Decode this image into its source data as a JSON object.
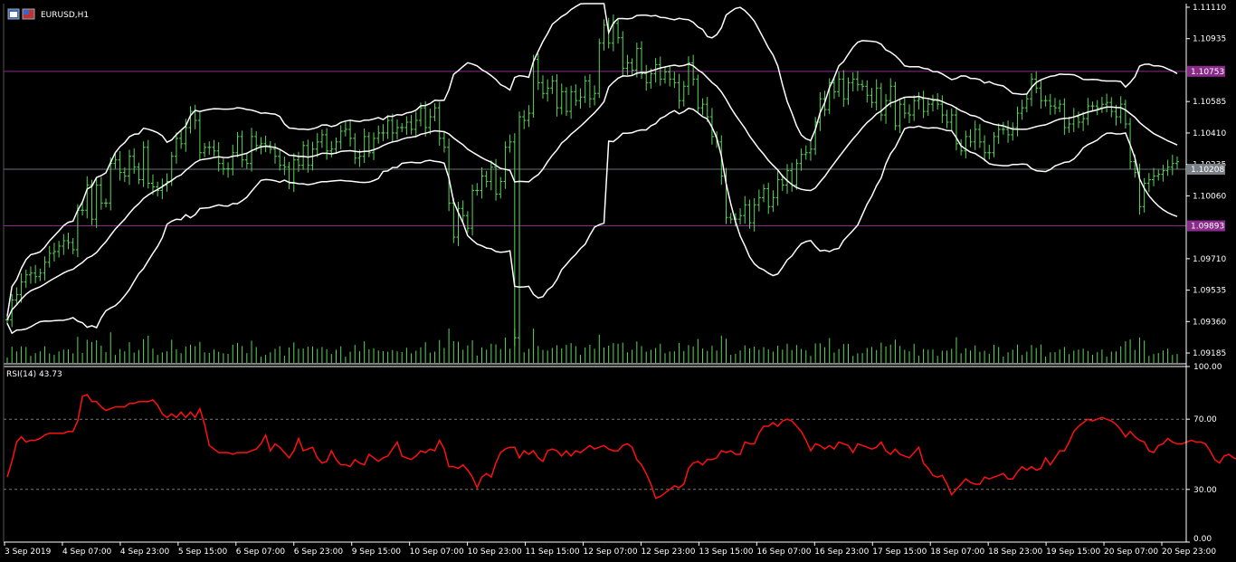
{
  "symbol_title": "EURUSD,H1",
  "rsi_title": "RSI(14) 43.73",
  "colors": {
    "background": "#000000",
    "axis": "#ffffff",
    "candle": "#5ad65a",
    "bollinger": "#ffffff",
    "rsi": "#ff1010",
    "hline": "#8a2a8a",
    "price_tag_magenta": "#8a2a8a",
    "price_tag_gray": "#7a7f86",
    "volume": "#5ad65a"
  },
  "price_ticks": [
    "1.11110",
    "1.10935",
    "1.10585",
    "1.10410",
    "1.10235",
    "1.10060",
    "1.09710",
    "1.09535",
    "1.09360",
    "1.09185"
  ],
  "rsi_ticks": [
    "100.00",
    "70.00",
    "30.00",
    "0.00"
  ],
  "time_ticks": [
    "3 Sep 2019",
    "4 Sep 07:00",
    "4 Sep 23:00",
    "5 Sep 15:00",
    "6 Sep 07:00",
    "6 Sep 23:00",
    "9 Sep 15:00",
    "10 Sep 07:00",
    "10 Sep 23:00",
    "11 Sep 15:00",
    "12 Sep 07:00",
    "12 Sep 23:00",
    "13 Sep 15:00",
    "16 Sep 07:00",
    "16 Sep 23:00",
    "17 Sep 15:00",
    "18 Sep 07:00",
    "18 Sep 23:00",
    "19 Sep 15:00",
    "20 Sep 07:00",
    "20 Sep 23:00"
  ],
  "price_labels": {
    "upper_level": "1.10753",
    "current": "1.10208",
    "lower_level": "1.09893"
  },
  "chart_data": {
    "type": "line",
    "price_axis": {
      "min": 1.0913,
      "max": 1.1113
    },
    "rsi_axis": {
      "min": 0,
      "max": 100,
      "levels": [
        70,
        30
      ]
    },
    "horizontal_levels": [
      1.10753,
      1.10208,
      1.09893
    ],
    "close": [
      1.0937,
      1.0948,
      1.0951,
      1.0958,
      1.0962,
      1.0963,
      1.0961,
      1.0963,
      1.0969,
      1.0974,
      1.0975,
      1.0978,
      1.0981,
      1.098,
      1.0976,
      1.0998,
      1.0998,
      1.1012,
      1.0993,
      1.1012,
      1.1002,
      1.1002,
      1.1024,
      1.1026,
      1.1019,
      1.1017,
      1.1028,
      1.1022,
      1.1015,
      1.1033,
      1.1013,
      1.1011,
      1.1009,
      1.1012,
      1.1014,
      1.1028,
      1.1038,
      1.1035,
      1.1044,
      1.1053,
      1.1048,
      1.103,
      1.1033,
      1.1033,
      1.1031,
      1.1024,
      1.1021,
      1.1021,
      1.103,
      1.1039,
      1.1026,
      1.1024,
      1.1039,
      1.1034,
      1.1035,
      1.1034,
      1.1032,
      1.1028,
      1.1023,
      1.1022,
      1.1013,
      1.1026,
      1.1023,
      1.1034,
      1.1023,
      1.1032,
      1.1036,
      1.104,
      1.1031,
      1.1032,
      1.1036,
      1.1042,
      1.1043,
      1.1038,
      1.1027,
      1.1028,
      1.1039,
      1.103,
      1.1038,
      1.1041,
      1.1041,
      1.1048,
      1.1041,
      1.1044,
      1.1044,
      1.1047,
      1.1043,
      1.1048,
      1.1055,
      1.1044,
      1.105,
      1.1055,
      1.1038,
      1.1033,
      1.1002,
      1.0983,
      1.0999,
      1.0995,
      1.0988,
      1.1009,
      1.1009,
      1.1017,
      1.1014,
      1.1022,
      1.1007,
      1.1014,
      1.1033,
      1.1036,
      1.0927,
      1.105,
      1.1048,
      1.1052,
      1.1082,
      1.1069,
      1.1063,
      1.1066,
      1.107,
      1.1055,
      1.1064,
      1.1053,
      1.1064,
      1.1059,
      1.1061,
      1.107,
      1.106,
      1.1063,
      1.1091,
      1.1101,
      1.1091,
      1.1102,
      1.1094,
      1.1077,
      1.108,
      1.1076,
      1.1088,
      1.1074,
      1.1069,
      1.1074,
      1.1079,
      1.1071,
      1.1075,
      1.1071,
      1.1069,
      1.1059,
      1.1067,
      1.108,
      1.1071,
      1.1055,
      1.1057,
      1.105,
      1.1039,
      1.1036,
      1.1017,
      1.0994,
      1.0993,
      1.0993,
      1.0995,
      1.1001,
      1.0991,
      1.1001,
      1.1005,
      1.101,
      1.1,
      1.1005,
      1.1015,
      1.1012,
      1.102,
      1.1012,
      1.1024,
      1.1029,
      1.103,
      1.1032,
      1.1047,
      1.106,
      1.1054,
      1.1069,
      1.1064,
      1.1071,
      1.106,
      1.1069,
      1.1071,
      1.1068,
      1.1067,
      1.1062,
      1.1058,
      1.1066,
      1.1051,
      1.1059,
      1.1067,
      1.1045,
      1.1057,
      1.1052,
      1.1051,
      1.1059,
      1.106,
      1.1053,
      1.1057,
      1.1059,
      1.1057,
      1.1051,
      1.1047,
      1.1051,
      1.1035,
      1.1031,
      1.1039,
      1.1036,
      1.1043,
      1.1036,
      1.103,
      1.103,
      1.1039,
      1.1043,
      1.1043,
      1.104,
      1.1044,
      1.1052,
      1.1055,
      1.106,
      1.1071,
      1.1066,
      1.1059,
      1.1059,
      1.1056,
      1.1055,
      1.1057,
      1.1044,
      1.1046,
      1.105,
      1.1047,
      1.1049,
      1.1056,
      1.1056,
      1.1055,
      1.1057,
      1.1058,
      1.1053,
      1.105,
      1.1057,
      1.1046,
      1.1025,
      1.1019,
      1.1,
      1.1013,
      1.1015,
      1.1017,
      1.1018,
      1.102,
      1.1022,
      1.1024,
      1.1025
    ],
    "rsi": [
      37,
      46,
      57,
      60,
      57,
      58,
      58,
      59,
      61,
      62,
      62,
      62,
      62,
      63,
      63,
      69,
      83,
      84,
      80,
      80,
      77,
      75,
      76,
      77,
      77,
      77,
      79,
      79,
      80,
      80,
      80,
      81,
      78,
      73,
      71,
      73,
      71,
      74,
      71,
      74,
      71,
      76,
      67,
      55,
      53,
      51,
      51,
      51,
      50,
      51,
      51,
      51,
      52,
      53,
      56,
      61,
      52,
      56,
      54,
      51,
      48,
      52,
      59,
      52,
      53,
      54,
      48,
      45,
      46,
      52,
      47,
      44,
      44,
      43,
      47,
      45,
      44,
      50,
      48,
      46,
      48,
      49,
      53,
      57,
      49,
      48,
      47,
      49,
      52,
      51,
      53,
      52,
      58,
      53,
      43,
      43,
      42,
      44,
      41,
      37,
      31,
      37,
      39,
      37,
      45,
      51,
      53,
      54,
      54,
      48,
      52,
      50,
      52,
      48,
      46,
      52,
      53,
      52,
      49,
      52,
      49,
      52,
      51,
      53,
      55,
      53,
      54,
      55,
      53,
      52,
      52,
      55,
      56,
      54,
      47,
      44,
      39,
      33,
      25,
      26,
      28,
      30,
      32,
      31,
      33,
      42,
      45,
      46,
      44,
      47,
      47,
      48,
      52,
      51,
      52,
      50,
      50,
      57,
      56,
      56,
      62,
      66,
      66,
      68,
      66,
      69,
      70,
      69,
      66,
      63,
      58,
      52,
      56,
      55,
      53,
      55,
      53,
      57,
      56,
      55,
      51,
      56,
      55,
      54,
      53,
      54,
      57,
      52,
      50,
      53,
      50,
      49,
      48,
      51,
      54,
      45,
      42,
      38,
      37,
      38,
      33,
      27,
      30,
      33,
      36,
      34,
      33,
      33,
      37,
      36,
      37,
      38,
      39,
      36,
      36,
      40,
      43,
      41,
      43,
      41,
      42,
      48,
      44,
      48,
      52,
      52,
      57,
      63,
      66,
      68,
      70,
      69,
      70,
      71,
      70,
      69,
      67,
      64,
      60,
      63,
      60,
      58,
      57,
      52,
      51,
      55,
      56,
      59,
      57,
      56,
      56,
      57,
      58,
      57,
      57,
      56,
      52,
      47,
      45,
      49,
      50,
      48,
      47,
      48,
      50,
      50,
      53,
      54,
      52,
      51,
      47,
      42,
      38,
      37,
      39,
      38,
      36,
      33,
      33,
      38,
      41,
      40,
      41,
      42,
      43,
      44,
      45,
      47,
      49,
      48,
      50
    ]
  }
}
